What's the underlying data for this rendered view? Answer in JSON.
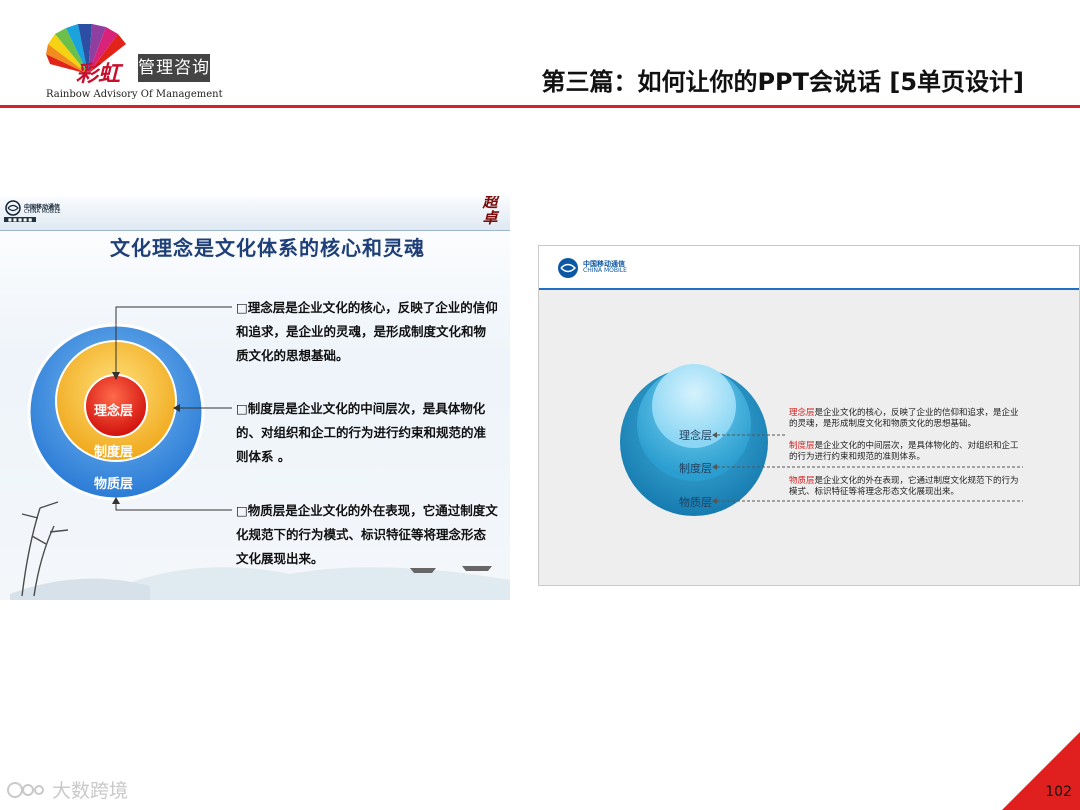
{
  "header": {
    "logo_name_cn": "管理咨询",
    "logo_mark_cn": "彩虹",
    "logo_name_en": "Rainbow  Advisory  Of  Management",
    "title": "第三篇：如何让你的PPT会说话 [5单页设计]"
  },
  "slide1": {
    "brand_cn": "中国移动通信",
    "brand_en": "CHINA MOBILE",
    "title": "文化理念是文化体系的核心和灵魂",
    "rings": {
      "inner": "理念层",
      "middle": "制度层",
      "outer": "物质层"
    },
    "paragraphs": [
      "□理念层是企业文化的核心，反映了企业的信仰和追求，是企业的灵魂，是形成制度文化和物质文化的思想基础。",
      "□制度层是企业文化的中间层次，是具体物化的、对组织和企工的行为进行约束和规范的准则体系 。",
      "□物质层是企业文化的外在表现，它通过制度文化规范下的行为模式、标识特征等将理念形态文化展现出来。"
    ]
  },
  "slide2": {
    "brand_cn": "中国移动通信",
    "brand_en": "CHINA MOBILE",
    "labels": [
      "理念层",
      "制度层",
      "物质层"
    ],
    "notes": [
      {
        "term": "理念层",
        "text": "是企业文化的核心，反映了企业的信仰和追求，是企业的灵魂，是形成制度文化和物质文化的思想基础。"
      },
      {
        "term": "制度层",
        "text": "是企业文化的中间层次，是具体物化的、对组织和企工的行为进行约束和规范的准则体系。"
      },
      {
        "term": "物质层",
        "text": "是企业文化的外在表现，它通过制度文化规范下的行为模式、标识特征等将理念形态文化展现出来。"
      }
    ]
  },
  "footer": {
    "page_number": "102",
    "watermark": "大数跨境"
  },
  "colors": {
    "accent_red": "#d7212a",
    "title_blue": "#1e3f78",
    "ring_blue": "#3a87dd",
    "ring_orange": "#f0a81c",
    "core_red": "#e0201f",
    "teal": "#1f8fbf"
  }
}
